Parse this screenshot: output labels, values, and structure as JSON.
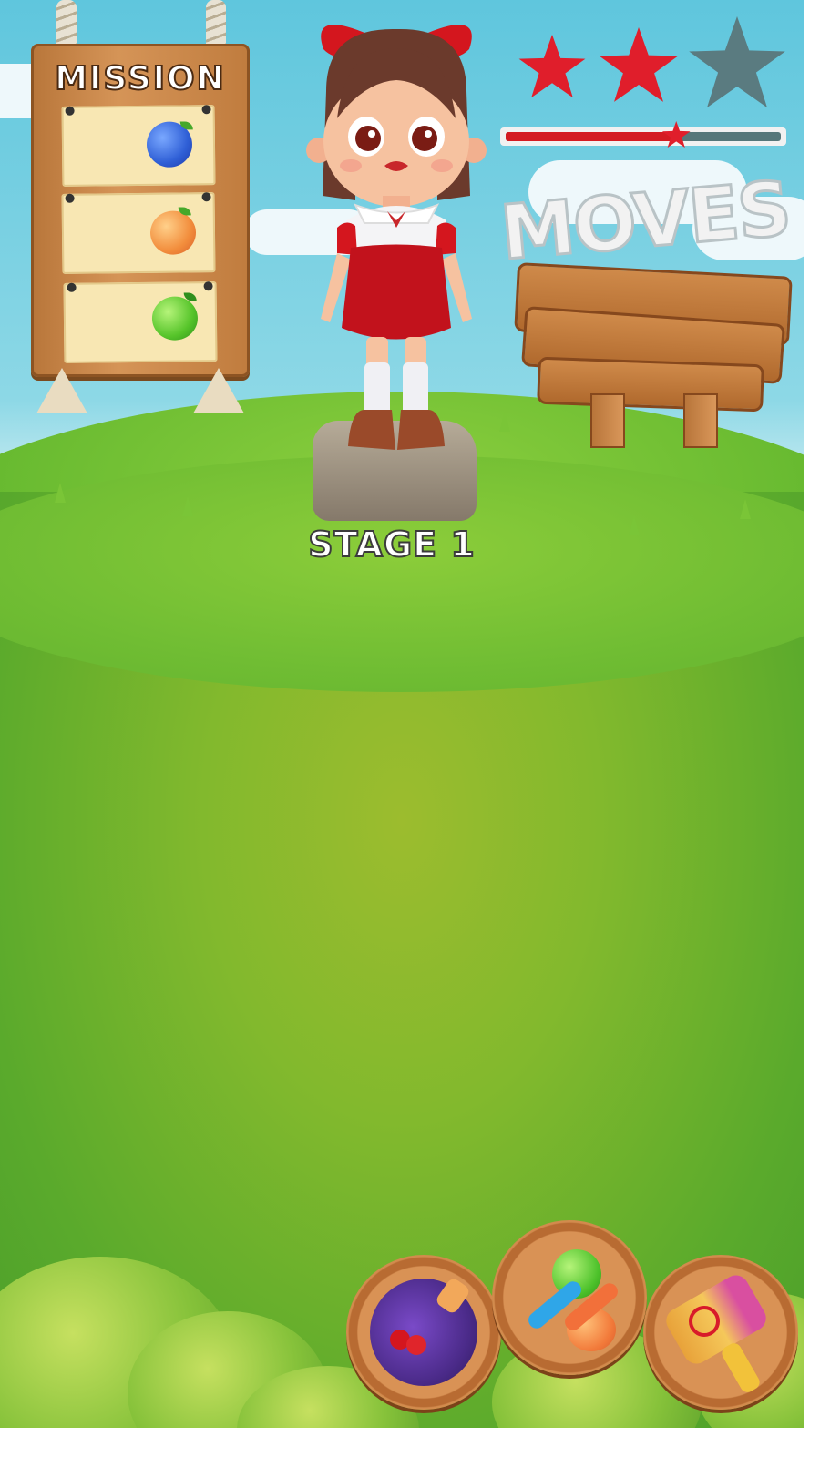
{
  "mission": {
    "title": "MISSION",
    "goals": [
      {
        "icon": "blueberry-icon",
        "color": "#2f6ee0"
      },
      {
        "icon": "peach-icon",
        "color": "#f08a3b"
      },
      {
        "icon": "green-apple-icon",
        "color": "#5ecb2d"
      }
    ]
  },
  "stars": {
    "earned": 2,
    "total": 3,
    "earned_color": "#e01e2b",
    "empty_color": "#5a7b80",
    "progress_percent": 62
  },
  "moves": {
    "title": "MOVES"
  },
  "stage": {
    "label": "STAGE 1"
  },
  "boosters": [
    {
      "name": "bomb-booster",
      "icon": "cherry-bomb-icon"
    },
    {
      "name": "swap-booster",
      "icon": "swap-arrows-icon"
    },
    {
      "name": "hammer-booster",
      "icon": "hammer-icon"
    }
  ]
}
